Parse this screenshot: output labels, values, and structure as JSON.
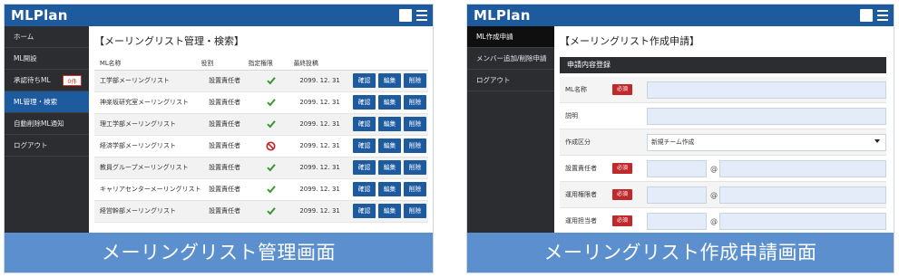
{
  "left": {
    "brand": "MLPlan",
    "sidebar": {
      "items": [
        {
          "label": "ホーム"
        },
        {
          "label": "ML開設"
        },
        {
          "label": "承認待ちML",
          "badge": "0件"
        },
        {
          "label": "ML管理・検索"
        },
        {
          "label": "自動削除ML通知"
        },
        {
          "label": "ログアウト"
        }
      ]
    },
    "title": "【メーリングリスト管理・検索】",
    "table": {
      "headers": [
        "ML名称",
        "役割",
        "指定権限",
        "最終投稿"
      ],
      "rows": [
        {
          "name": "工学部メーリングリスト",
          "role": "設置責任者",
          "perm": "check",
          "date": "2099. 12. 31"
        },
        {
          "name": "神楽坂研究室メーリングリスト",
          "role": "設置責任者",
          "perm": "check",
          "date": "2099. 12. 31"
        },
        {
          "name": "理工学部メーリングリスト",
          "role": "設置責任者",
          "perm": "check",
          "date": "2099. 12. 31"
        },
        {
          "name": "経済学部メーリングリスト",
          "role": "設置責任者",
          "perm": "prohibited",
          "date": "2099. 12. 31"
        },
        {
          "name": "教員グループメーリングリスト",
          "role": "設置責任者",
          "perm": "check",
          "date": "2099. 12. 31"
        },
        {
          "name": "キャリアセンターメーリングリスト",
          "role": "設置責任者",
          "perm": "check",
          "date": "2099. 12. 31"
        },
        {
          "name": "経営幹部メーリングリスト",
          "role": "設置責任者",
          "perm": "check",
          "date": "2099. 12. 31"
        }
      ],
      "actions": [
        "確認",
        "編集",
        "削除"
      ]
    },
    "caption": "メーリングリスト管理画面"
  },
  "right": {
    "brand": "MLPlan",
    "sidebar": {
      "items": [
        {
          "label": "ML作成申請"
        },
        {
          "label": "メンバー追加/削除申請"
        },
        {
          "label": "ログアウト"
        }
      ]
    },
    "title": "【メーリングリスト作成申請】",
    "section": "申請内容登録",
    "required_label": "必須",
    "fields": {
      "ml_name": "ML名称",
      "description": "説明",
      "creation_type": "作成区分",
      "creation_type_value": "新規チーム作成",
      "owner": "設置責任者",
      "operator": "運用権限者",
      "partial": "運用担当者",
      "at": "@"
    },
    "caption": "メーリングリスト作成申請画面"
  },
  "colors": {
    "brand_blue": "#1e5a9e",
    "sidebar_dark": "#2b2d30",
    "caption_blue": "#5b8fcd",
    "required_red": "#c0282a",
    "check_green": "#3a9a2e",
    "prohibit_red": "#c0282a",
    "input_fill": "#e3ecf8"
  }
}
